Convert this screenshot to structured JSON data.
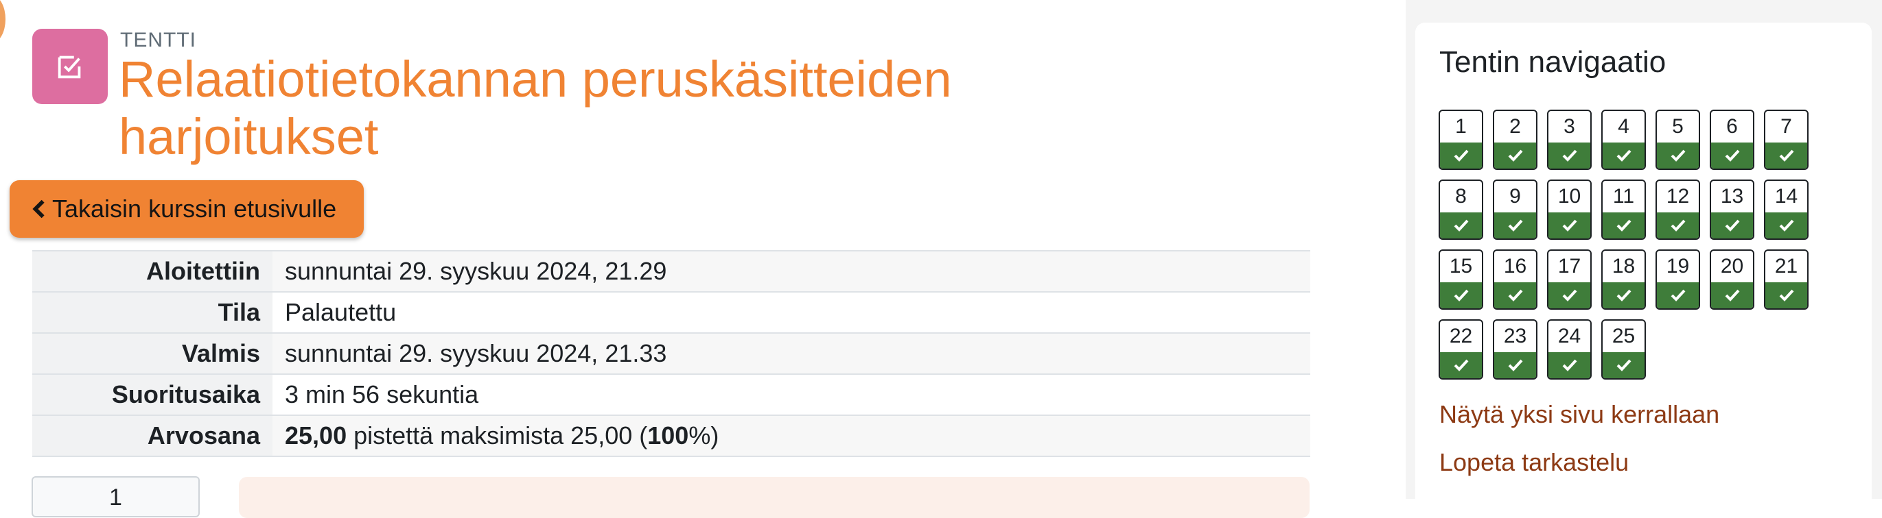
{
  "header": {
    "pre_title": "TENTTI",
    "title": "Relaatiotietokannan peruskäsitteiden harjoitukset",
    "icon": "checkbox-icon",
    "icon_color": "#dd6ea0",
    "title_color": "#f08333"
  },
  "back_button": {
    "label": "Takaisin kurssin etusivulle",
    "icon": "chevron-left-icon"
  },
  "summary": [
    {
      "label": "Aloitettiin",
      "value": "sunnuntai 29. syyskuu 2024, 21.29"
    },
    {
      "label": "Tila",
      "value": "Palautettu"
    },
    {
      "label": "Valmis",
      "value": "sunnuntai 29. syyskuu 2024, 21.33"
    },
    {
      "label": "Suoritusaika",
      "value": "3 min 56 sekuntia"
    },
    {
      "label": "Arvosana",
      "score": "25,00",
      "mid": " pistettä maksimista 25,00 (",
      "percent": "100",
      "suffix": "%)"
    }
  ],
  "question_info": {
    "number": "1"
  },
  "navigation": {
    "title": "Tentin navigaatio",
    "questions": [
      "1",
      "2",
      "3",
      "4",
      "5",
      "6",
      "7",
      "8",
      "9",
      "10",
      "11",
      "12",
      "13",
      "14",
      "15",
      "16",
      "17",
      "18",
      "19",
      "20",
      "21",
      "22",
      "23",
      "24",
      "25"
    ],
    "question_state": "correct",
    "state_color": "#3f7d3a",
    "links": [
      "Näytä yksi sivu kerrallaan",
      "Lopeta tarkastelu"
    ]
  }
}
